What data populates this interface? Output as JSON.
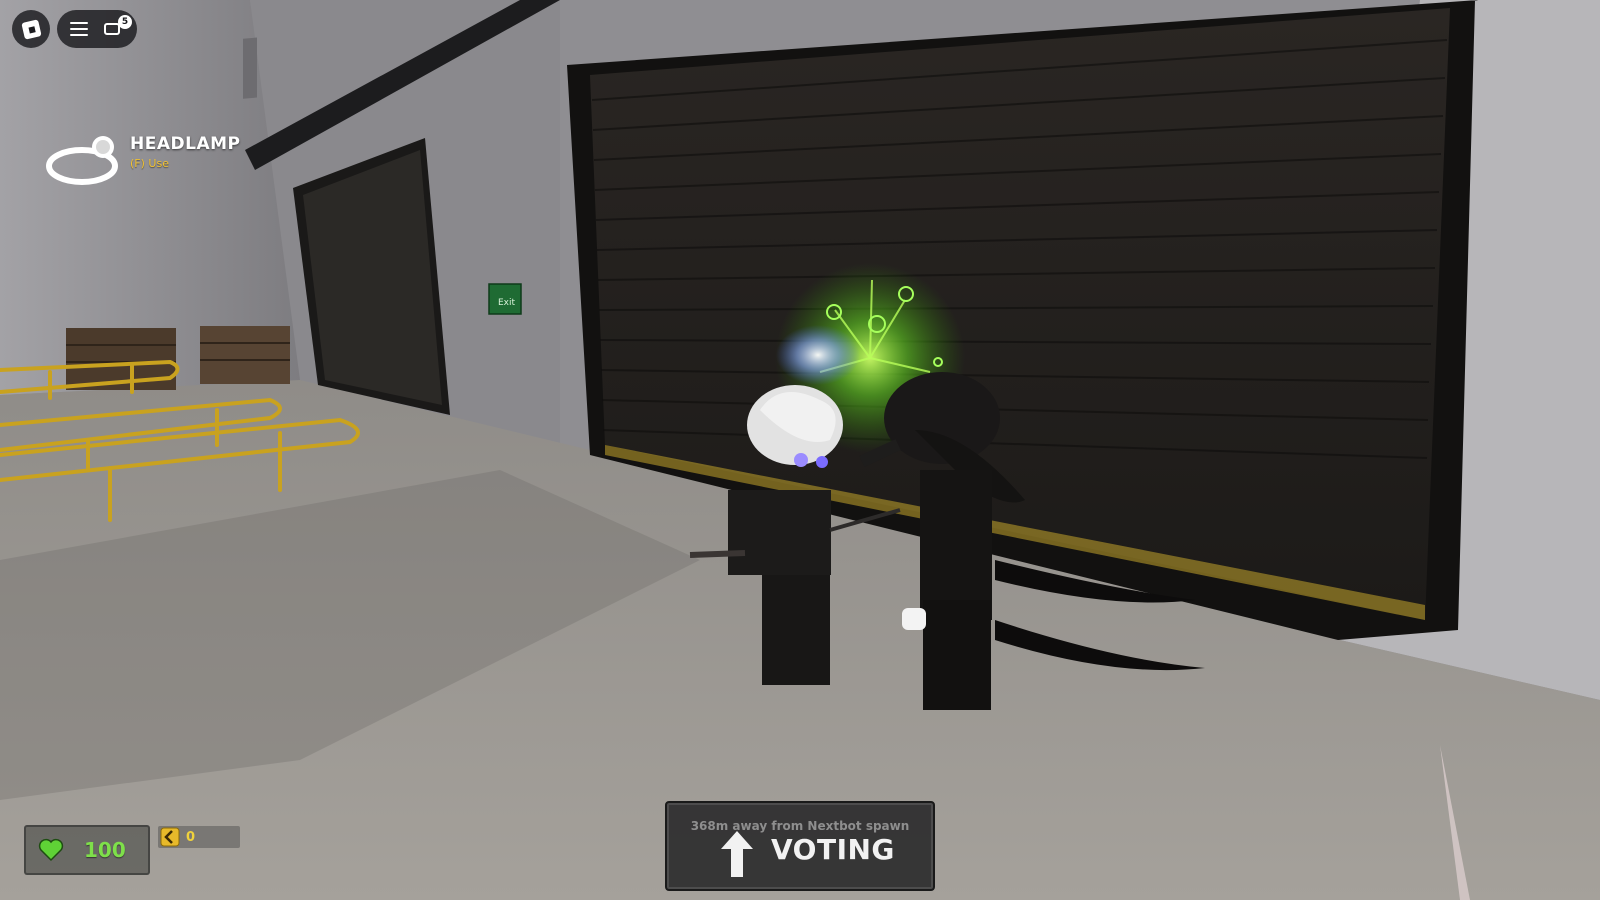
{
  "topbar": {
    "logo_icon": "roblox-logo-icon",
    "menu_icon": "hamburger-menu-icon",
    "chat_icon": "chat-icon",
    "chat_badge_count": "5"
  },
  "item": {
    "icon": "headlamp-icon",
    "name": "HEADLAMP",
    "hint": "(F) Use"
  },
  "hud": {
    "health_icon": "heart-icon",
    "health_value": "100",
    "health_color": "#7ee04a",
    "currency_icon": "coin-icon",
    "currency_value": "0",
    "currency_color": "#f0d23c"
  },
  "status": {
    "distance_text": "368m away from Nextbot spawn",
    "arrow_icon": "up-arrow-icon",
    "phase_label": "VOTING"
  },
  "scene": {
    "exit_sign": "Exit"
  }
}
